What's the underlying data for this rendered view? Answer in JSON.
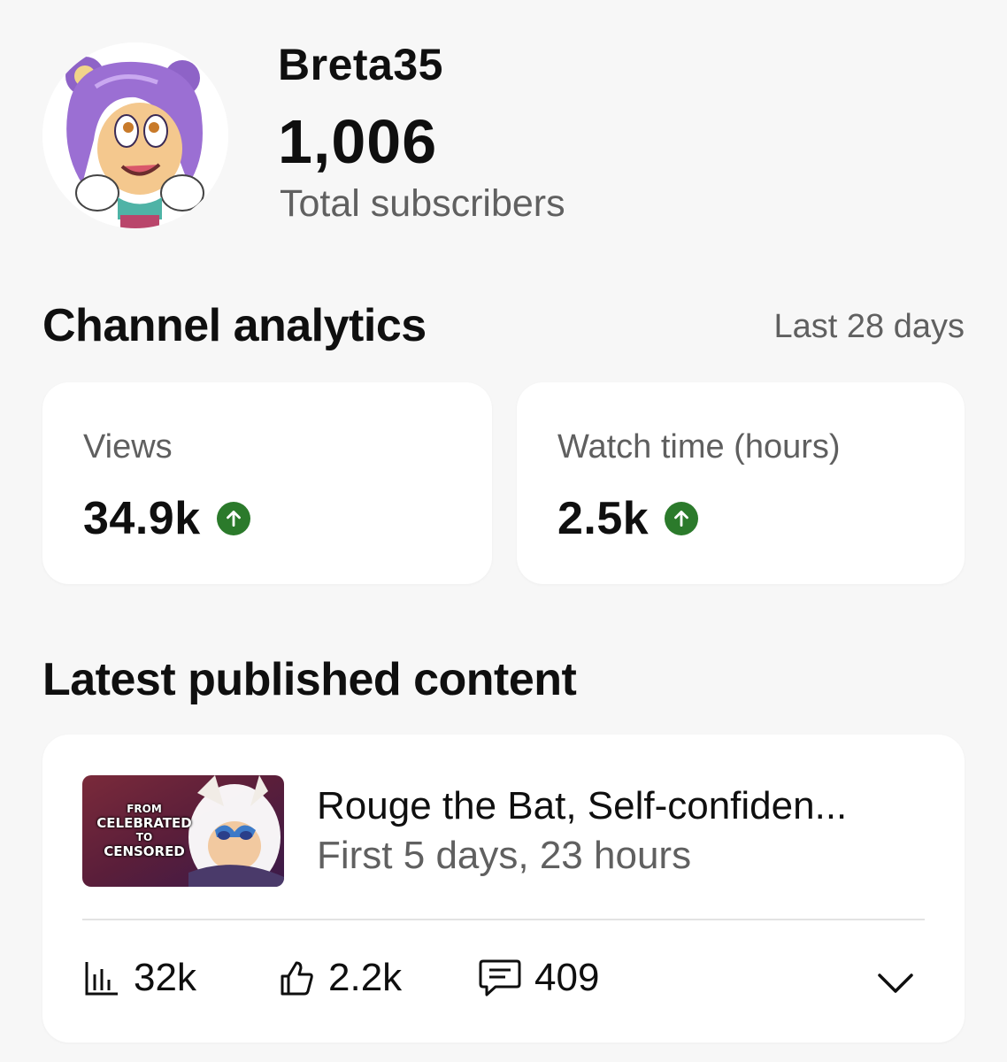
{
  "channel": {
    "name": "Breta35",
    "subscriber_count": "1,006",
    "subscriber_label": "Total subscribers",
    "avatar_icon": "cartoon-character-avatar"
  },
  "analytics": {
    "title": "Channel analytics",
    "period": "Last 28 days",
    "metrics": [
      {
        "label": "Views",
        "value": "34.9k",
        "trend": "up",
        "trend_color": "#2b7a2b"
      },
      {
        "label": "Watch time (hours)",
        "value": "2.5k",
        "trend": "up",
        "trend_color": "#2b7a2b"
      }
    ]
  },
  "latest": {
    "title": "Latest published content",
    "video": {
      "title": "Rouge the Bat, Self-confiden...",
      "period": "First 5 days, 23 hours",
      "thumbnail_text": [
        "FROM",
        "CELEBRATED",
        "TO",
        "CENSORED"
      ],
      "stats": {
        "views": "32k",
        "likes": "2.2k",
        "comments": "409"
      }
    }
  }
}
